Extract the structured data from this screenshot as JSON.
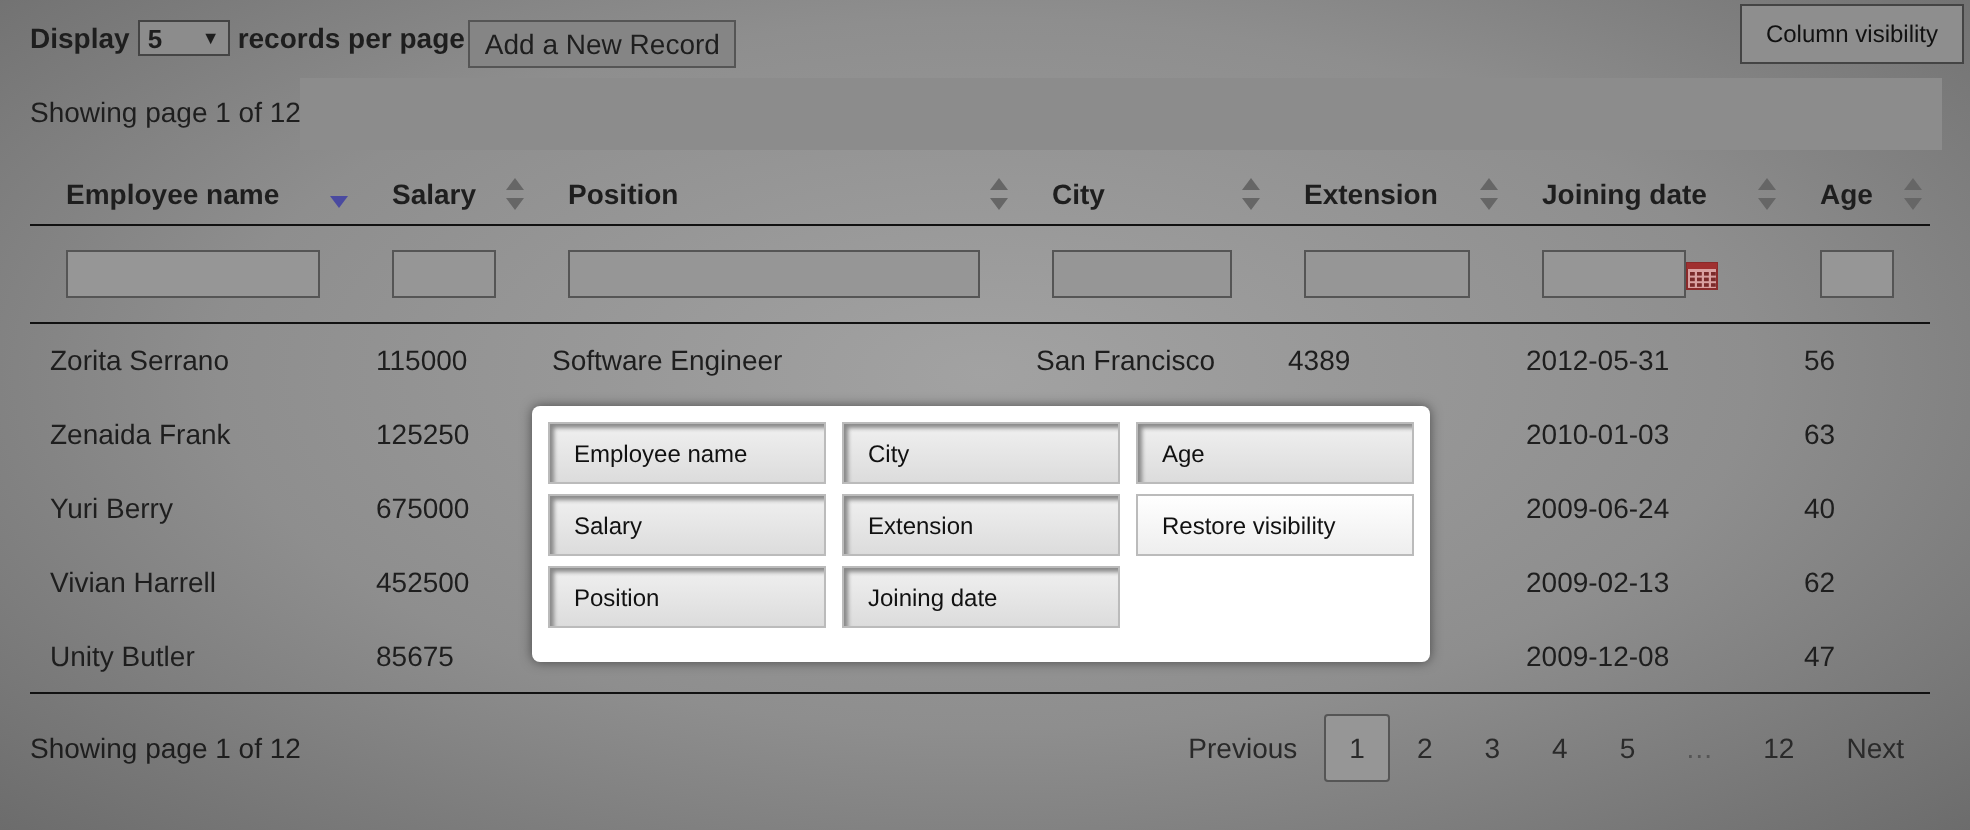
{
  "length_menu": {
    "before": "Display",
    "value": "5",
    "caret": "▼",
    "after": "records per page"
  },
  "add_button": {
    "label": "Add a New Record"
  },
  "column_visibility_button": {
    "label": "Column visibility"
  },
  "info_top": "Showing page 1 of 12",
  "table": {
    "columns": [
      {
        "label": "Employee name",
        "sorted": true,
        "kind": "text"
      },
      {
        "label": "Salary",
        "sorted": false,
        "kind": "text"
      },
      {
        "label": "Position",
        "sorted": false,
        "kind": "text"
      },
      {
        "label": "City",
        "sorted": false,
        "kind": "text"
      },
      {
        "label": "Extension",
        "sorted": false,
        "kind": "text"
      },
      {
        "label": "Joining date",
        "sorted": false,
        "kind": "date"
      },
      {
        "label": "Age",
        "sorted": false,
        "kind": "text"
      }
    ],
    "rows": [
      [
        "Zorita Serrano",
        "115000",
        "Software Engineer",
        "San Francisco",
        "4389",
        "2012-05-31",
        "56"
      ],
      [
        "Zenaida Frank",
        "125250",
        null,
        null,
        null,
        "2010-01-03",
        "63"
      ],
      [
        "Yuri Berry",
        "675000",
        null,
        null,
        null,
        "2009-06-24",
        "40"
      ],
      [
        "Vivian Harrell",
        "452500",
        null,
        null,
        null,
        "2009-02-13",
        "62"
      ],
      [
        "Unity Butler",
        "85675",
        null,
        null,
        null,
        "2009-12-08",
        "47"
      ]
    ]
  },
  "info_bottom": "Showing page 1 of 12",
  "pagination": [
    {
      "label": "Previous",
      "selected": false
    },
    {
      "label": "1",
      "selected": true
    },
    {
      "label": "2",
      "selected": false
    },
    {
      "label": "3",
      "selected": false
    },
    {
      "label": "4",
      "selected": false
    },
    {
      "label": "5",
      "selected": false
    },
    {
      "label": "…",
      "kind": "ellipsis"
    },
    {
      "label": "12",
      "selected": false
    },
    {
      "label": "Next",
      "selected": false
    }
  ],
  "column_popup": {
    "buttons": [
      {
        "label": "Employee name",
        "kind": "column"
      },
      {
        "label": "City",
        "kind": "column"
      },
      {
        "label": "Age",
        "kind": "column"
      },
      {
        "label": "Salary",
        "kind": "column"
      },
      {
        "label": "Extension",
        "kind": "column"
      },
      {
        "label": "Restore visibility",
        "kind": "restore"
      },
      {
        "label": "Position",
        "kind": "column"
      },
      {
        "label": "Joining date",
        "kind": "column"
      }
    ]
  }
}
